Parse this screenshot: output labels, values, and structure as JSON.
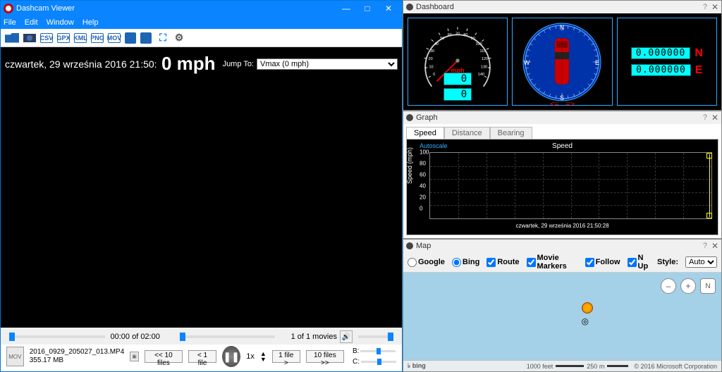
{
  "main": {
    "title": "Dashcam Viewer",
    "menu": [
      "File",
      "Edit",
      "Window",
      "Help"
    ],
    "toolbar_labels": {
      "csv": "CSV",
      "gpx": "GPX",
      "kml": "KML",
      "png": "PNG",
      "mov": "MOV"
    },
    "timestamp": "czwartek, 29 września 2016 21:50:",
    "speed": "0 mph",
    "jump_label": "Jump To:",
    "jump_value": "Vmax (0 mph)",
    "time_display": "00:00 of 02:00",
    "movies_display": "1 of 1 movies",
    "filename": "2016_0929_205027_013.MP4",
    "filesize": "355.17 MB",
    "nav": {
      "back10": "<< 10 files",
      "back1": "< 1 file",
      "fwd1": "1 file >",
      "fwd10": "10 files >>"
    },
    "rate": "1x",
    "mini_labels": {
      "b": "B:",
      "c": "C:"
    }
  },
  "dashboard": {
    "title": "Dashboard",
    "mph_label": "mph",
    "speed_val": "0",
    "dist_val": "0",
    "lat": "0.000000",
    "lat_dir": "N",
    "lon": "0.000000",
    "lon_dir": "E",
    "ticks": [
      "0",
      "10",
      "20",
      "30",
      "40",
      "50",
      "60",
      "70",
      "80",
      "90",
      "100",
      "110",
      "120",
      "130",
      "140"
    ],
    "compass_dirs": {
      "n": "N",
      "e": "E",
      "s": "S",
      "w": "W"
    },
    "arrows": {
      "l": "<=",
      "r": "=>"
    }
  },
  "graph": {
    "title": "Graph",
    "tabs": [
      "Speed",
      "Distance",
      "Bearing"
    ],
    "active_tab": "Speed",
    "autoscale": "Autoscale",
    "chart_title": "Speed",
    "yaxis": "Speed (mph)",
    "yticks": [
      "0",
      "20",
      "40",
      "60",
      "80",
      "100"
    ],
    "x_label": "czwartek, 29 września 2016 21:50:28"
  },
  "map": {
    "title": "Map",
    "providers": {
      "google": "Google",
      "bing": "Bing"
    },
    "selected_provider": "bing",
    "opts": {
      "route": "Route",
      "markers": "Movie Markers",
      "follow": "Follow",
      "nup": "N Up"
    },
    "style_label": "Style:",
    "style_value": "Auto",
    "zoom_minus": "–",
    "zoom_plus": "+",
    "north": "N",
    "brand": "bing",
    "scale_feet": "1000 feet",
    "scale_m": "250 m",
    "copyright": "© 2016 Microsoft Corporation"
  },
  "chart_data": {
    "type": "line",
    "title": "Speed",
    "ylabel": "Speed (mph)",
    "ylim": [
      0,
      100
    ],
    "x": [
      "czwartek, 29 września 2016 21:50:28"
    ],
    "series": [
      {
        "name": "Speed",
        "values": [
          0,
          100
        ]
      }
    ]
  }
}
